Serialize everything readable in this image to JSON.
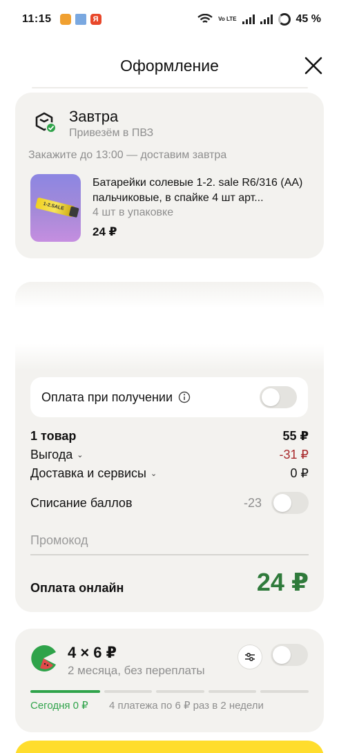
{
  "status_bar": {
    "time": "11:15",
    "battery": "45 %",
    "network": "Vo LTE"
  },
  "header": {
    "title": "Оформление"
  },
  "delivery": {
    "title": "Завтра",
    "subtitle": "Привезём в ПВЗ",
    "note": "Закажите до 13:00 — доставим завтра",
    "product": {
      "name": "Батарейки солевые 1-2. sale R6/316 (AA) пальчиковые, в спайке 4 шт арт...",
      "pack": "4 шт в упаковке",
      "price": "24 ₽",
      "image_label": "1-2.SALE"
    }
  },
  "summary": {
    "cash_on_delivery": "Оплата при получении",
    "items_label": "1 товар",
    "items_value": "55 ₽",
    "benefit_label": "Выгода",
    "benefit_value": "-31 ₽",
    "delivery_label": "Доставка и сервисы",
    "delivery_value": "0 ₽",
    "points_label": "Списание баллов",
    "points_value": "-23",
    "promo_placeholder": "Промокод",
    "pay_label": "Оплата онлайн",
    "pay_total": "24 ₽"
  },
  "split": {
    "title": "4 × 6 ₽",
    "subtitle": "2 месяца, без переплаты",
    "today": "Сегодня 0 ₽",
    "plan": "4 платежа по 6 ₽ раз в 2 недели",
    "progress_steps": 5,
    "progress_done": 1
  },
  "colors": {
    "card_bg": "#f3f2ef",
    "discount": "#a8282b",
    "total": "#2f7a3b",
    "split_green": "#2fa34a",
    "cta_yellow": "#ffdd2d"
  }
}
